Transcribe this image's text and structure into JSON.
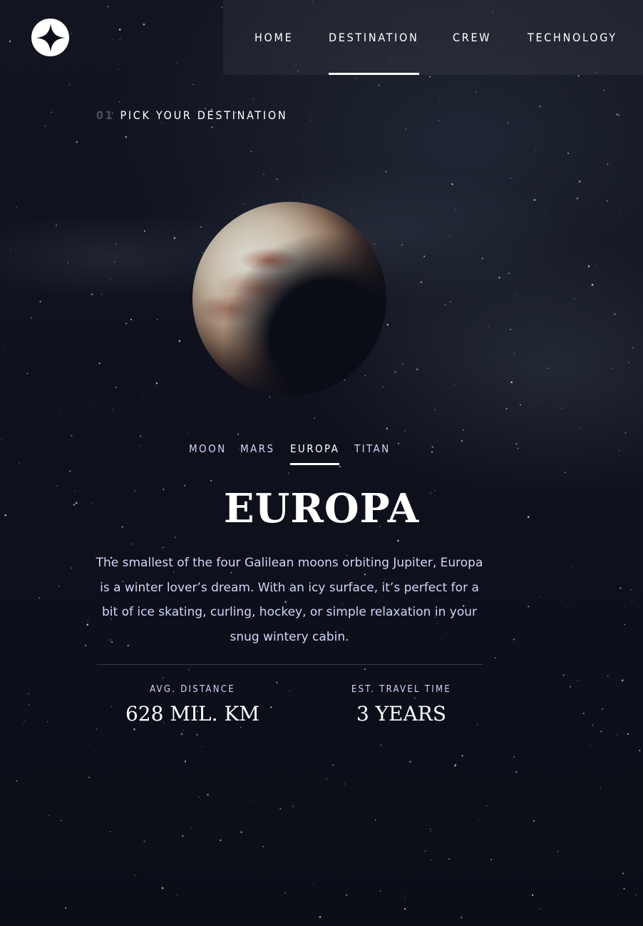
{
  "nav": {
    "items": [
      {
        "label": "HOME",
        "active": false
      },
      {
        "label": "DESTINATION",
        "active": true
      },
      {
        "label": "CREW",
        "active": false
      },
      {
        "label": "TECHNOLOGY",
        "active": false
      }
    ]
  },
  "eyebrow": {
    "number": "01",
    "text": "PICK YOUR DESTINATION"
  },
  "destination_tabs": [
    {
      "label": "MOON",
      "active": false
    },
    {
      "label": "MARS",
      "active": false
    },
    {
      "label": "EUROPA",
      "active": true
    },
    {
      "label": "TITAN",
      "active": false
    }
  ],
  "destination": {
    "name": "EUROPA",
    "description": "The smallest of the four Galilean moons orbiting Jupiter, Europa is a winter lover’s dream. With an icy surface, it’s perfect for a bit of ice skating, curling, hockey, or simple relaxation in your snug wintery cabin.",
    "distance_label": "AVG. DISTANCE",
    "distance_value": "628 MIL. KM",
    "travel_label": "EST. TRAVEL TIME",
    "travel_value": "3 YEARS"
  },
  "icons": {
    "logo": "star-logo-icon"
  },
  "colors": {
    "background": "#0b0d17",
    "text_light": "#d0d6f9",
    "white": "#ffffff"
  }
}
